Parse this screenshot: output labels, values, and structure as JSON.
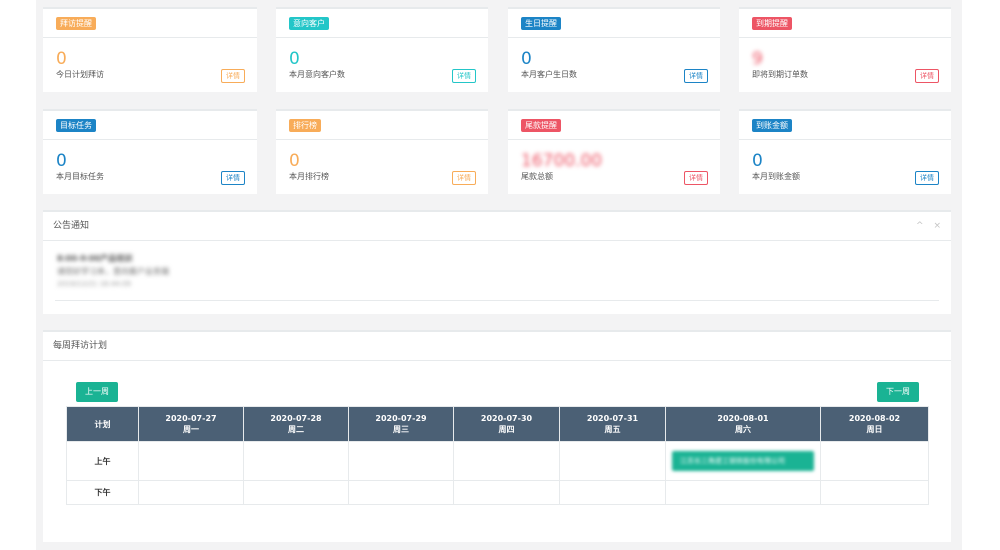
{
  "cards": [
    {
      "badge": "拜访提醒",
      "value": "0",
      "sub": "今日计划拜访",
      "detail": "详情",
      "color": "orange"
    },
    {
      "badge": "意向客户",
      "value": "0",
      "sub": "本月意向客户数",
      "detail": "详情",
      "color": "teal"
    },
    {
      "badge": "生日提醒",
      "value": "0",
      "sub": "本月客户生日数",
      "detail": "详情",
      "color": "blue"
    },
    {
      "badge": "到期提醒",
      "value": "9",
      "sub": "即将到期订单数",
      "detail": "详情",
      "color": "red"
    },
    {
      "badge": "目标任务",
      "value": "0",
      "sub": "本月目标任务",
      "detail": "详情",
      "color": "blue"
    },
    {
      "badge": "排行榜",
      "value": "0",
      "sub": "本月排行榜",
      "detail": "详情",
      "color": "orange"
    },
    {
      "badge": "尾款提醒",
      "value": "16700.00",
      "sub": "尾款总额",
      "detail": "详情",
      "color": "red"
    },
    {
      "badge": "到账金额",
      "value": "0",
      "sub": "本月到账金额",
      "detail": "详情",
      "color": "blue"
    }
  ],
  "notice": {
    "title": "公告通知",
    "tool_up": "^",
    "tool_close": "×",
    "line1": "8:00-9:00产品培训",
    "line2": "请您好学习本，意向客户业务端",
    "line3": "2019/12/21 16:44:09"
  },
  "schedule": {
    "title": "每周拜访计划",
    "prev": "上一周",
    "next": "下一周",
    "header_plan": "计划",
    "days": [
      {
        "date": "2020-07-27",
        "weekday": "周一"
      },
      {
        "date": "2020-07-28",
        "weekday": "周二"
      },
      {
        "date": "2020-07-29",
        "weekday": "周三"
      },
      {
        "date": "2020-07-30",
        "weekday": "周四"
      },
      {
        "date": "2020-07-31",
        "weekday": "周五"
      },
      {
        "date": "2020-08-01",
        "weekday": "周六"
      },
      {
        "date": "2020-08-02",
        "weekday": "周日"
      }
    ],
    "row_am": "上午",
    "row_pm": "下午",
    "event_text": "江苏长三角建工钢铁股份有限公司"
  },
  "colors": {
    "orange": "#f8ac59",
    "teal": "#23c6c8",
    "blue": "#1c84c6",
    "red": "#ed5565",
    "green": "#1ab394",
    "header": "#4b6075"
  }
}
